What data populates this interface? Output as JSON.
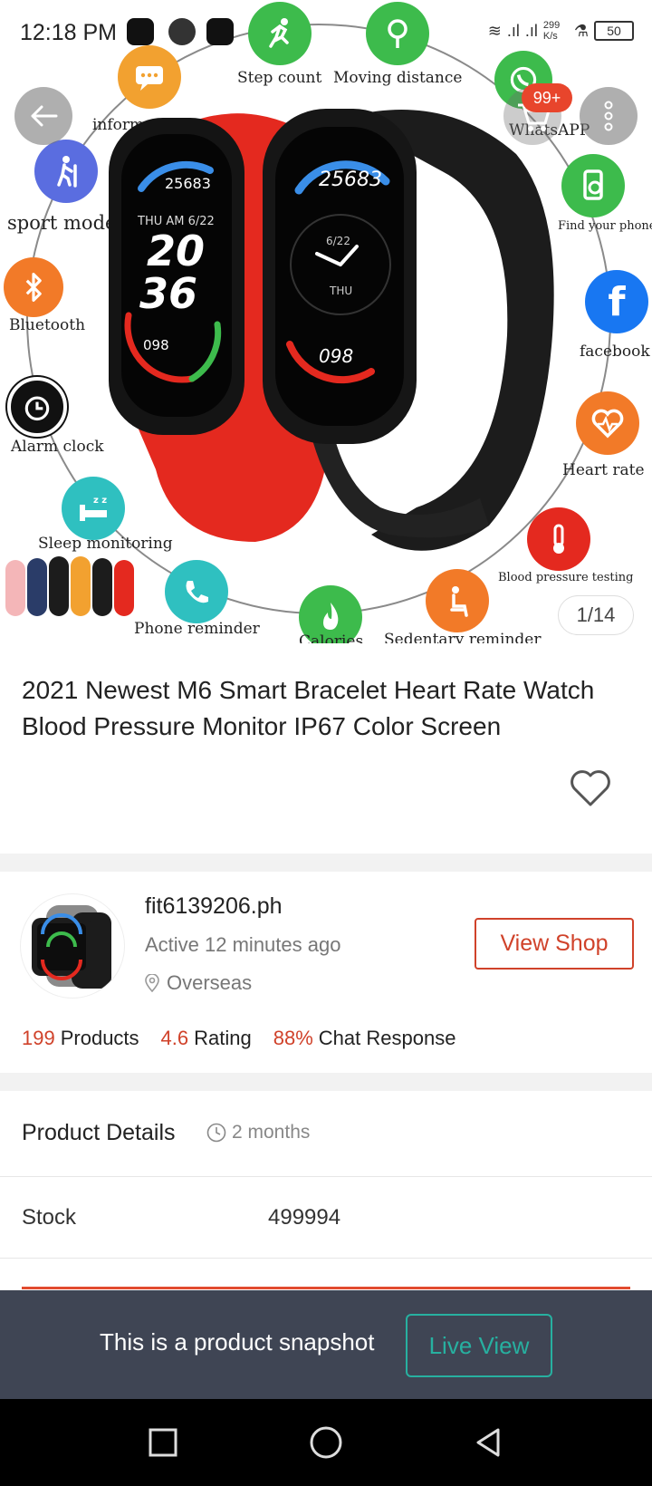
{
  "status_bar": {
    "time": "12:18 PM",
    "net_speed": "299 K/s",
    "battery": "50"
  },
  "hero": {
    "features": {
      "step_count": "Step count",
      "moving_distance": "Moving distance",
      "information": "information",
      "whatsapp": "WhatsAPP",
      "sport_modes": "sport modes",
      "find_phone": "Find your phone",
      "bluetooth": "Bluetooth",
      "facebook": "facebook",
      "alarm_clock": "Alarm clock",
      "heart_rate": "Heart rate",
      "sleep_monitoring": "Sleep monitoring",
      "blood_pressure": "Blood pressure testing",
      "phone_reminder": "Phone reminder",
      "calories": "Calories",
      "sedentary_reminder": "Sedentary reminder"
    },
    "watch_left": {
      "steps": "25683",
      "date": "THU AM 6/22",
      "hour": "20",
      "minute": "36",
      "hr": "098"
    },
    "watch_right": {
      "steps": "25683",
      "date": "6/22",
      "day": "THU",
      "hr": "098"
    },
    "cart_badge": "99+",
    "image_counter": "1/14",
    "colors": {
      "band_red": "#e4291f",
      "band_black": "#1c1c1c",
      "accent": "#e8452c"
    }
  },
  "product": {
    "title": "2021 Newest M6 Smart Bracelet Heart Rate Watch Blood Pressure Monitor IP67 Color Screen"
  },
  "shop": {
    "name": "fit6139206.ph",
    "active": "Active 12 minutes ago",
    "location": "Overseas",
    "view_shop_label": "View Shop",
    "stats": [
      {
        "num": "199",
        "label": "Products"
      },
      {
        "num": "4.6",
        "label": "Rating"
      },
      {
        "num": "88%",
        "label": "Chat Response"
      }
    ]
  },
  "details": {
    "title": "Product Details",
    "updated": "2 months",
    "stock_label": "Stock",
    "stock_value": "499994"
  },
  "snapshot": {
    "text": "This is a product snapshot",
    "button": "Live View",
    "colors": {
      "bar": "#3f4554",
      "button": "#27b0a0"
    }
  }
}
